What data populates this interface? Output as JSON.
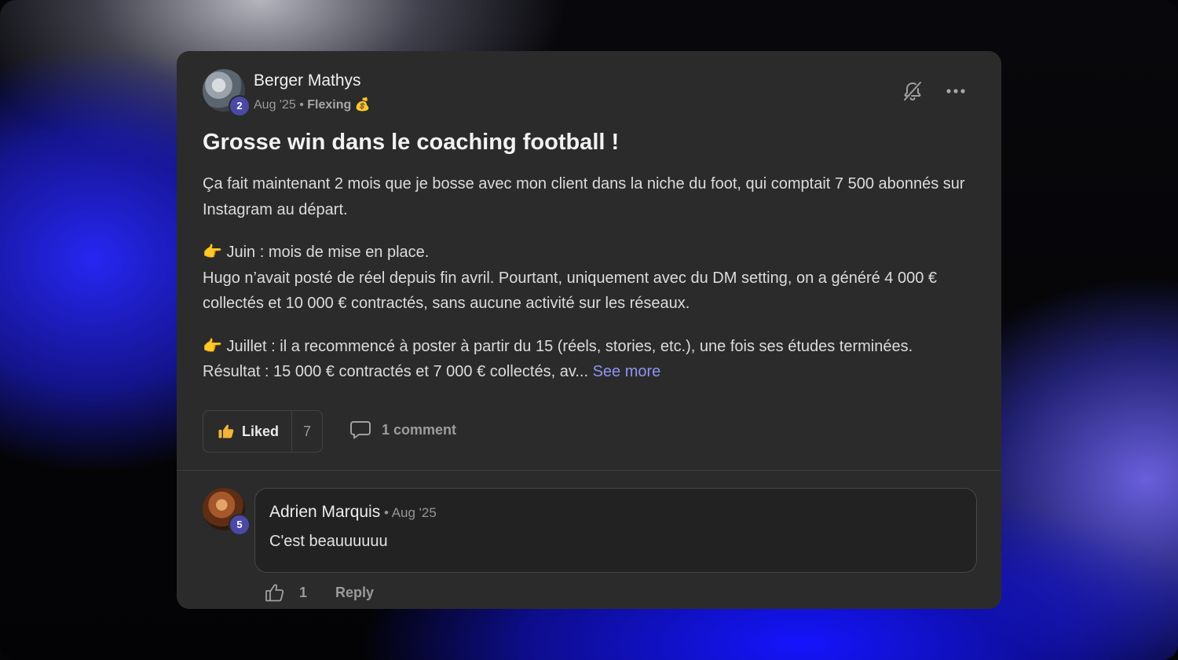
{
  "post": {
    "author": "Berger Mathys",
    "author_level": "2",
    "date": "Aug '25",
    "separator": " • ",
    "category": "Flexing",
    "category_emoji": "💰",
    "title": "Grosse win dans le coaching football !",
    "paragraphs": [
      "Ça fait maintenant 2 mois que je bosse avec mon client dans la niche du foot, qui comptait 7 500 abonnés sur Instagram au départ.",
      "👉 Juin : mois de mise en place.",
      "Hugo n’avait posté de réel depuis fin avril. Pourtant, uniquement avec du DM setting, on a généré 4 000 € collectés et 10 000 € contractés, sans aucune activité sur les réseaux.",
      "👉 Juillet : il a recommencé à poster à partir du 15 (réels, stories, etc.), une fois ses études terminées.",
      "Résultat : 15 000 € contractés et 7 000 € collectés, av... "
    ],
    "see_more": "See more",
    "liked_label": "Liked",
    "like_count": "7",
    "comment_label": "1 comment",
    "icons": {
      "mute": "bell-off-icon",
      "menu": "more-dots-icon",
      "like": "thumbs-up-filled-icon",
      "comment": "comment-bubble-icon"
    }
  },
  "comment": {
    "author": "Adrien Marquis",
    "author_level": "5",
    "date": " • Aug '25",
    "text": "C'est beauuuuuu",
    "like_count": "1",
    "reply_label": "Reply",
    "icons": {
      "like": "thumbs-up-outline-icon"
    }
  },
  "colors": {
    "card": "#2b2b2b",
    "accent_link": "#8f94f0",
    "badge": "#4a49a6",
    "like_icon": "#f3b43a"
  }
}
